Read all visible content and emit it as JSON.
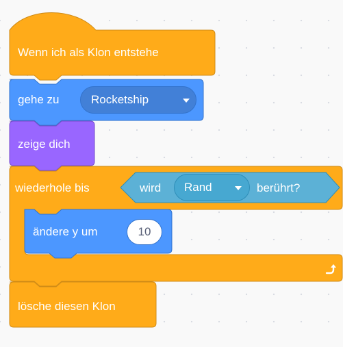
{
  "colors": {
    "events": "#ffab19",
    "control": "#ffab19",
    "motion": "#4c97ff",
    "looks": "#9966ff",
    "sensing": "#5cb1d6",
    "workspace": "#f9f9f9"
  },
  "hat_block": {
    "label": "Wenn ich als Klon entstehe"
  },
  "goto_block": {
    "label": "gehe zu",
    "target": "Rocketship"
  },
  "show_block": {
    "label": "zeige dich"
  },
  "repeat_until_block": {
    "label": "wiederhole bis",
    "condition": {
      "prefix": "wird",
      "menu": "Rand",
      "suffix": "berührt?"
    },
    "loop_icon": "loop-arrow-icon"
  },
  "change_y_block": {
    "label": "ändere y um",
    "value": "10"
  },
  "delete_clone_block": {
    "label": "lösche diesen Klon"
  }
}
